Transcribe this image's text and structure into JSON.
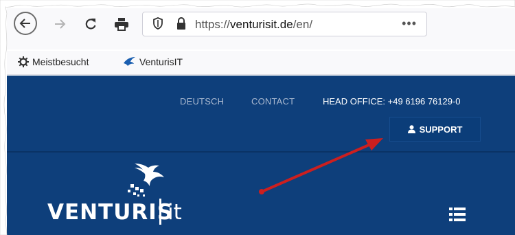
{
  "browser": {
    "url_prefix": "https://",
    "url_domain": "venturisit.de",
    "url_path": "/en/",
    "more_label": "•••",
    "bookmarks": [
      {
        "label": "Meistbesucht",
        "icon": "gear-icon"
      },
      {
        "label": "VenturisIT",
        "icon": "venturis-favicon"
      }
    ]
  },
  "site": {
    "nav": {
      "deutsch": "DEUTSCH",
      "contact": "CONTACT",
      "head_office": "HEAD OFFICE: +49 6196 76129-0"
    },
    "support_label": "SUPPORT",
    "logo_text": "VENTURIS",
    "logo_suffix": "it",
    "colors": {
      "header_bg": "#0e3f7b",
      "arrow": "#cc1f1f"
    }
  }
}
